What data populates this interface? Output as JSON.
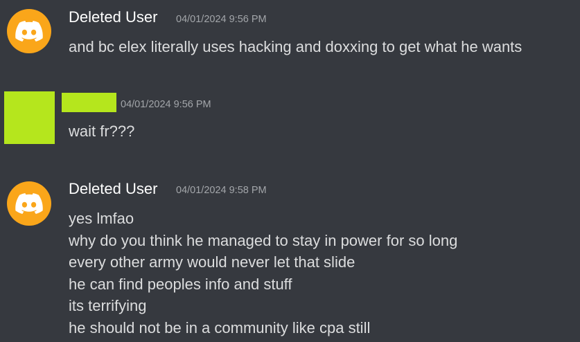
{
  "messages": [
    {
      "author": "Deleted User",
      "timestamp": "04/01/2024 9:56 PM",
      "avatar_icon": "discord-logo-icon",
      "lines": [
        "and bc elex literally uses hacking and doxxing to get what he wants"
      ]
    },
    {
      "author": "",
      "timestamp": "04/01/2024 9:56 PM",
      "avatar_icon": "redacted",
      "lines": [
        "wait fr???"
      ]
    },
    {
      "author": "Deleted User",
      "timestamp": "04/01/2024 9:58 PM",
      "avatar_icon": "discord-logo-icon",
      "lines": [
        "yes lmfao",
        "why do you think he managed to stay in power for so long",
        "every other army would never let that slide",
        "he can find peoples info and stuff",
        "its terrifying",
        "he should not be in a community like cpa still"
      ]
    }
  ],
  "colors": {
    "background": "#36393f",
    "avatar_orange": "#faa61a",
    "redaction_green": "#b5e61d",
    "username": "#ffffff",
    "timestamp": "#a3a6aa",
    "text": "#dcddde"
  }
}
